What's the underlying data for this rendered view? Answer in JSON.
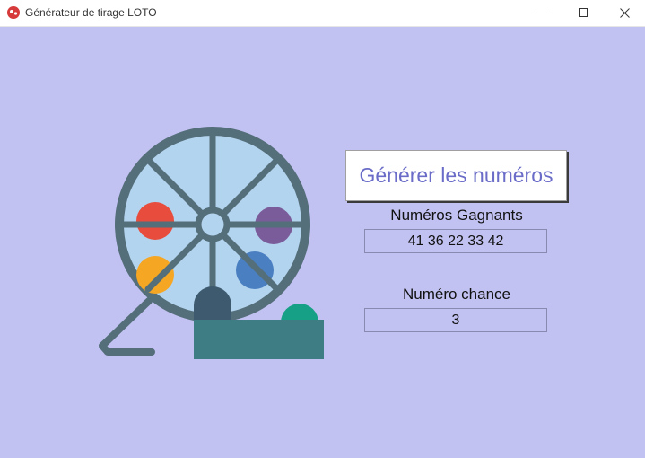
{
  "window": {
    "title": "Générateur de tirage LOTO",
    "controls": [
      "minimize",
      "maximize",
      "close"
    ]
  },
  "main": {
    "generate_button_label": "Générer les numéros",
    "winning_numbers_label": "Numéros Gagnants",
    "winning_numbers_value": "41 36 22 33 42",
    "chance_number_label": "Numéro chance",
    "chance_number_value": "3"
  },
  "icons": {
    "app": "lottery-app-icon",
    "illustration": "lottery-drum-illustration"
  },
  "colors": {
    "background": "#c2c2f2",
    "button_text": "#6a6cc8",
    "drum_frame": "#546e7a",
    "drum_fill": "#b3d4ef",
    "ball_red": "#e74c3c",
    "ball_purple": "#7b5c9a",
    "ball_orange": "#f5a623",
    "ball_blue": "#4a7fc1",
    "ball_green": "#16a085",
    "tray": "#3f7d84"
  }
}
